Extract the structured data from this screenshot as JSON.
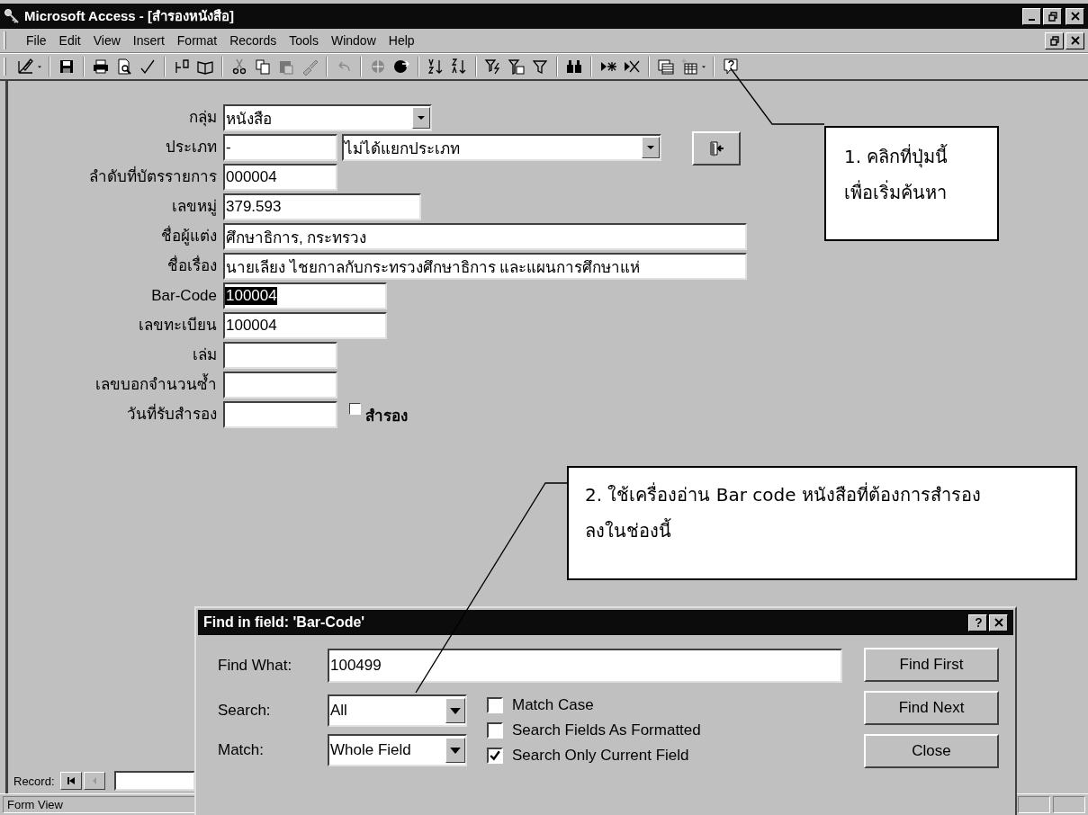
{
  "window": {
    "title": "Microsoft Access - [สำรองหนังสือ]"
  },
  "menu": [
    "File",
    "Edit",
    "View",
    "Insert",
    "Format",
    "Records",
    "Tools",
    "Window",
    "Help"
  ],
  "form": {
    "fields": [
      {
        "label": "กลุ่ม",
        "kind": "combo",
        "value": "หนังสือ"
      },
      {
        "label": "ประเภท",
        "kind": "pair",
        "value": "-",
        "value2": "ไม่ได้แยกประเภท"
      },
      {
        "label": "ลำดับที่บัตรรายการ",
        "kind": "text",
        "value": "000004"
      },
      {
        "label": "เลขหมู่",
        "kind": "text",
        "value": "379.593"
      },
      {
        "label": "ชื่อผู้แต่ง",
        "kind": "text",
        "value": "ศึกษาธิการ, กระทรวง"
      },
      {
        "label": "ชื่อเรื่อง",
        "kind": "text",
        "value": "นายเลียง  ไชยกาลกับกระทรวงศึกษาธิการ และแผนการศึกษาแห่"
      },
      {
        "label": "Bar-Code",
        "kind": "text",
        "value": "100004",
        "highlighted": true
      },
      {
        "label": "เลขทะเบียน",
        "kind": "text",
        "value": "100004"
      },
      {
        "label": "เล่ม",
        "kind": "text"
      },
      {
        "label": "เลขบอกจำนวนซ้ำ",
        "kind": "text"
      },
      {
        "label": "วันที่รับสำรอง",
        "kind": "check",
        "check": {
          "label": "สำรอง",
          "checked": false
        }
      }
    ]
  },
  "record_nav": {
    "label": "Record:"
  },
  "status_bar": {
    "text": "Form View"
  },
  "dialog": {
    "title": "Find in field: 'Bar-Code'",
    "find_label": "Find What:",
    "find_value": "100499",
    "search_label": "Search:",
    "search_value": "All",
    "match_label": "Match:",
    "match_value": "Whole Field",
    "options": [
      {
        "label": "Match Case",
        "checked": false
      },
      {
        "label": "Search Fields As Formatted",
        "checked": false
      },
      {
        "label": "Search Only Current Field",
        "checked": true
      }
    ],
    "buttons": [
      "Find First",
      "Find Next",
      "Close"
    ]
  },
  "callouts": [
    "1. คลิกที่ปุ่มนี้\nเพื่อเริ่มค้นหา",
    "2. ใช้เครื่องอ่าน Bar code หนังสือที่ต้องการสำรอง\nลงในช่องนี้"
  ]
}
